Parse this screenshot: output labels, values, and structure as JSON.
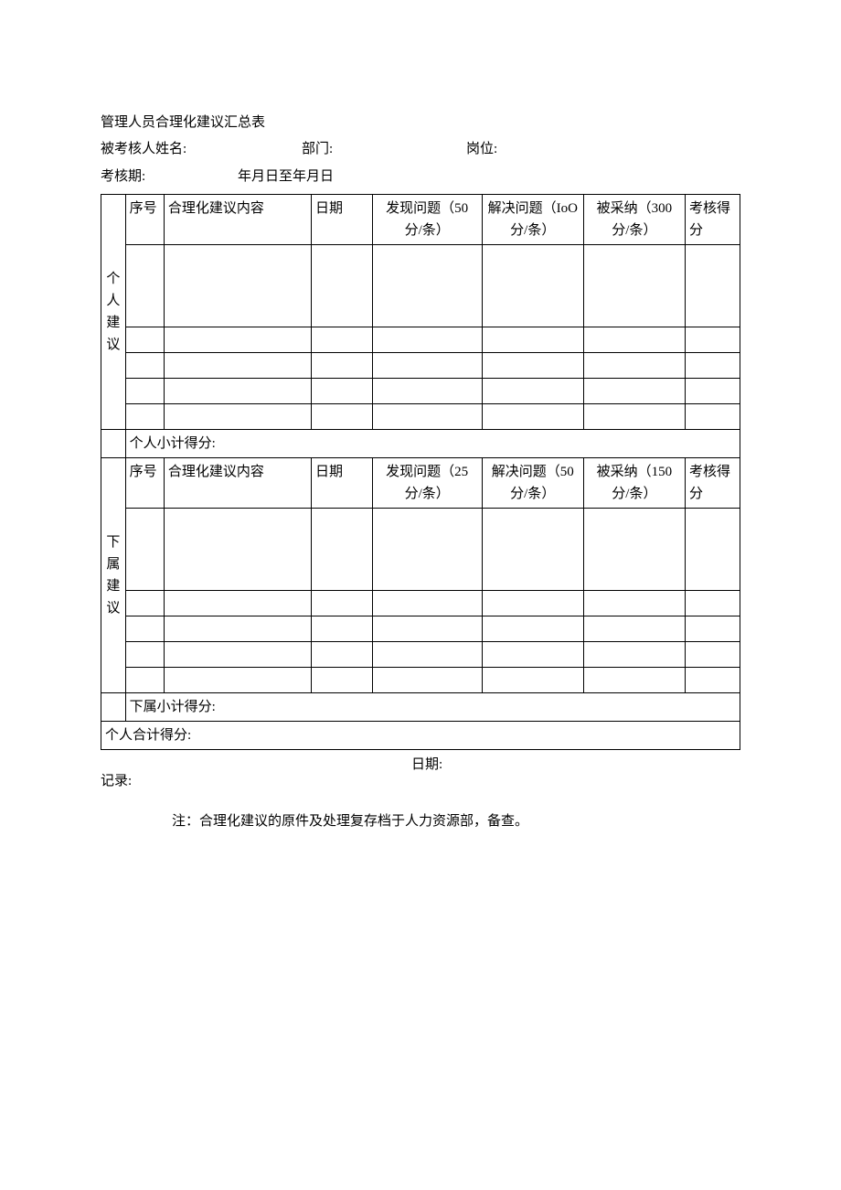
{
  "title": "管理人员合理化建议汇总表",
  "fields": {
    "name_label": "被考核人姓名:",
    "dept_label": "部门:",
    "post_label": "岗位:",
    "period_label": "考核期:",
    "period_text": "年月日至年月日"
  },
  "section1": {
    "label": "个人建议",
    "headers": {
      "seq": "序号",
      "content": "合理化建议内容",
      "date": "日期",
      "find": "发现问题（50 分/条）",
      "solve": "解决问题（IoO 分/条）",
      "adopt": "被采纳（300 分/条）",
      "score": "考核得分"
    },
    "subtotal": "个人小计得分:"
  },
  "section2": {
    "label": "下属建议",
    "headers": {
      "seq": "序号",
      "content": "合理化建议内容",
      "date": "日期",
      "find": "发现问题（25 分/条）",
      "solve": "解决问题（50 分/条）",
      "adopt": "被采纳（150 分/条）",
      "score": "考核得分"
    },
    "subtotal": "下属小计得分:"
  },
  "total": "个人合计得分:",
  "footer": {
    "recorder": "记录:",
    "date": "日期:"
  },
  "note": "注：合理化建议的原件及处理复存档于人力资源部，备查。"
}
